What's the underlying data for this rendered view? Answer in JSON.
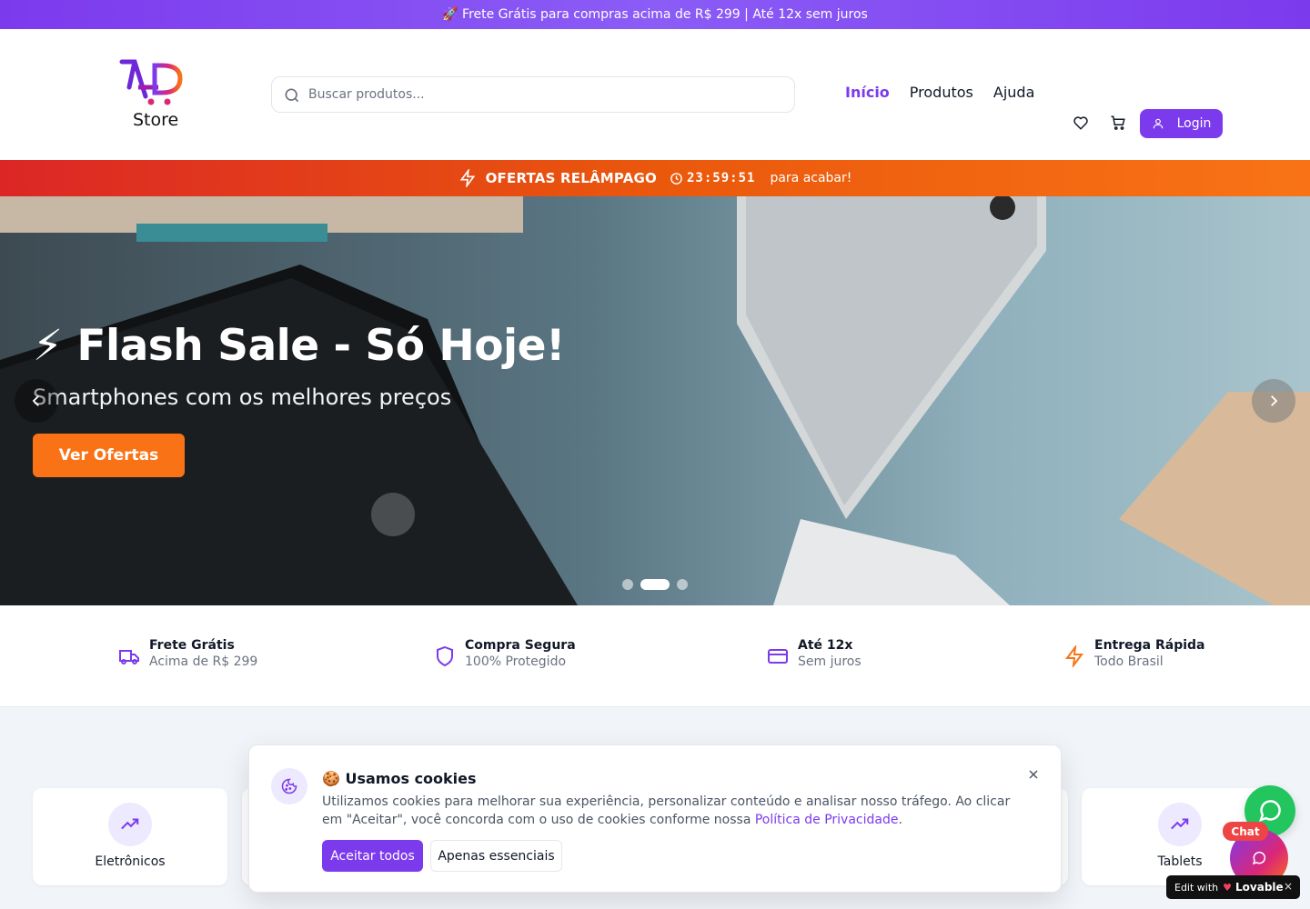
{
  "promo": {
    "text": "🚀 Frete Grátis para compras acima de R$ 299 | Até 12x sem juros"
  },
  "header": {
    "logo_text": "Store",
    "search_placeholder": "Buscar produtos...",
    "nav": [
      {
        "label": "Início",
        "active": true
      },
      {
        "label": "Produtos",
        "active": false
      },
      {
        "label": "Ajuda",
        "active": false
      }
    ],
    "login_label": "Login",
    "icons": [
      "heart-icon",
      "cart-icon",
      "user-icon"
    ]
  },
  "flash_bar": {
    "title": "OFERTAS RELÂMPAGO",
    "timer": "23:59:51",
    "suffix": "para acabar!"
  },
  "hero": {
    "title": "⚡ Flash Sale - Só Hoje!",
    "subtitle": "Smartphones com os melhores preços",
    "cta": "Ver Ofertas",
    "slides": 3,
    "active_slide": 2
  },
  "features": [
    {
      "title": "Frete Grátis",
      "subtitle": "Acima de R$ 299",
      "icon": "truck-icon",
      "color": "#7c3aed"
    },
    {
      "title": "Compra Segura",
      "subtitle": "100% Protegido",
      "icon": "shield-icon",
      "color": "#7c3aed"
    },
    {
      "title": "Até 12x",
      "subtitle": "Sem juros",
      "icon": "credit-card-icon",
      "color": "#7c3aed"
    },
    {
      "title": "Entrega Rápida",
      "subtitle": "Todo Brasil",
      "icon": "zap-icon",
      "color": "#f97316"
    }
  ],
  "categories": [
    {
      "label": "Eletrônicos",
      "icon": "trending-up-icon"
    },
    {
      "label": "Tablets",
      "icon": "trending-up-icon"
    }
  ],
  "cookie": {
    "title": "🍪 Usamos cookies",
    "text": "Utilizamos cookies para melhorar sua experiência, personalizar conteúdo e analisar nosso tráfego. Ao clicar em \"Aceitar\", você concorda com o uso de cookies conforme nossa ",
    "link": "Política de Privacidade",
    "text_end": ".",
    "accept": "Aceitar todos",
    "essential": "Apenas essenciais"
  },
  "chat": {
    "badge": "Chat"
  },
  "lovable": {
    "prefix": "Edit with",
    "brand": "Lovable",
    "close": "×"
  },
  "colors": {
    "primary": "#7c3aed",
    "accent": "#f97316",
    "whatsapp": "#22c55e"
  }
}
